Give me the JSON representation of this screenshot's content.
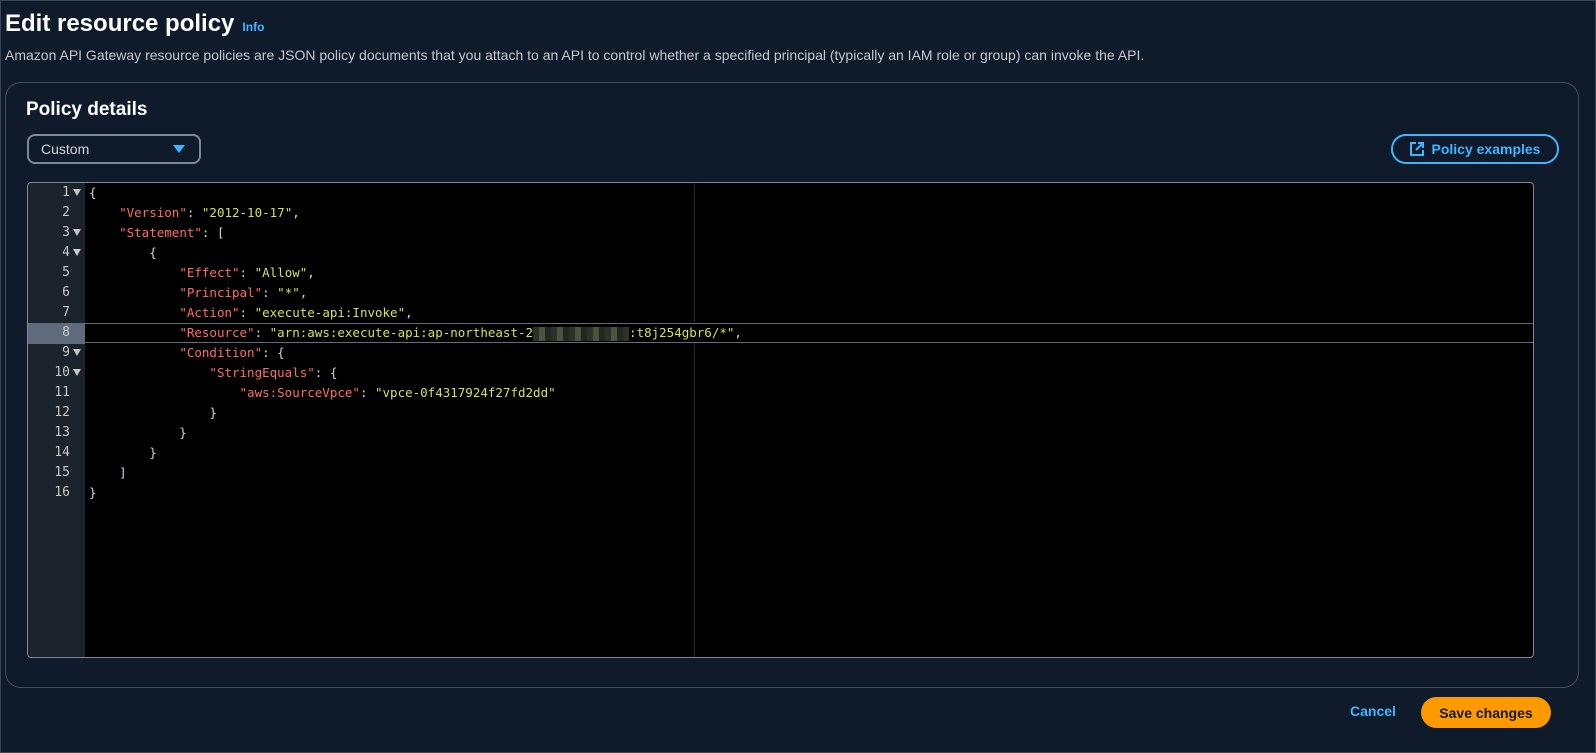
{
  "header": {
    "title": "Edit resource policy",
    "info": "Info",
    "description": "Amazon API Gateway resource policies are JSON policy documents that you attach to an API to control whether a specified principal (typically an IAM role or group) can invoke the API."
  },
  "panel": {
    "title": "Policy details",
    "template_select": {
      "value": "Custom"
    },
    "examples_button": "Policy examples"
  },
  "editor": {
    "active_line": 8,
    "lines": [
      {
        "n": "1",
        "fold": true
      },
      {
        "n": "2",
        "fold": false
      },
      {
        "n": "3",
        "fold": true
      },
      {
        "n": "4",
        "fold": true
      },
      {
        "n": "5",
        "fold": false
      },
      {
        "n": "6",
        "fold": false
      },
      {
        "n": "7",
        "fold": false
      },
      {
        "n": "8",
        "fold": false
      },
      {
        "n": "9",
        "fold": true
      },
      {
        "n": "10",
        "fold": true
      },
      {
        "n": "11",
        "fold": false
      },
      {
        "n": "12",
        "fold": false
      },
      {
        "n": "13",
        "fold": false
      },
      {
        "n": "14",
        "fold": false
      },
      {
        "n": "15",
        "fold": false
      },
      {
        "n": "16",
        "fold": false
      }
    ],
    "tokens": {
      "version_key": "\"Version\"",
      "version_val": "\"2012-10-17\"",
      "statement_key": "\"Statement\"",
      "effect_key": "\"Effect\"",
      "effect_val": "\"Allow\"",
      "principal_key": "\"Principal\"",
      "principal_val": "\"*\"",
      "action_key": "\"Action\"",
      "action_val": "\"execute-api:Invoke\"",
      "resource_key": "\"Resource\"",
      "resource_val_start": "\"arn:aws:execute-api:ap-northeast-2",
      "resource_val_end": ":t8j254gbr6/*\"",
      "condition_key": "\"Condition\"",
      "stringequals_key": "\"StringEquals\"",
      "sourcevpce_key": "\"aws:SourceVpce\"",
      "sourcevpce_val": "\"vpce-0f4317924f27fd2dd\""
    }
  },
  "footer": {
    "cancel": "Cancel",
    "save": "Save changes"
  },
  "colors": {
    "accent": "#42b4ff",
    "primary_button": "#ff9900",
    "json_key": "#ff6b6b",
    "json_string": "#d4e157"
  }
}
